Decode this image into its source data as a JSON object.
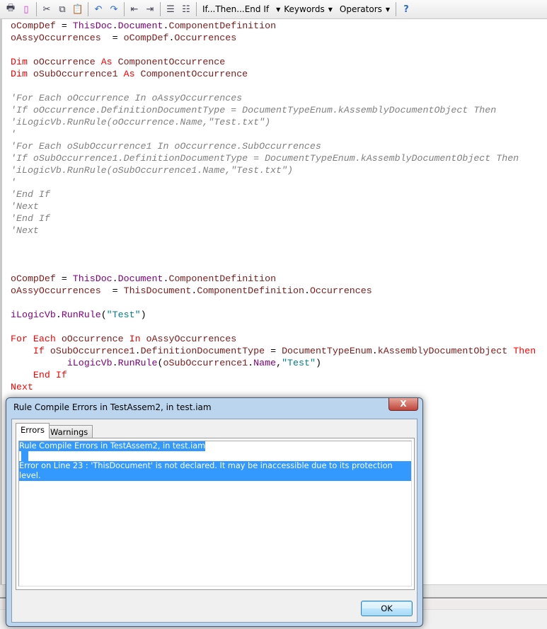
{
  "toolbar": {
    "icons": [
      "print-icon",
      "print-preview-icon",
      "cut-icon",
      "copy-icon",
      "paste-icon",
      "undo-icon",
      "redo-icon",
      "outdent-icon",
      "indent-icon",
      "comment-icon",
      "uncomment-icon"
    ],
    "if_then_label": "If...Then...End If",
    "keywords_label": "Keywords",
    "operators_label": "Operators",
    "help_icon": "help-icon"
  },
  "colors": {
    "variable": "#801818",
    "member": "#800080",
    "keyword": "#ff0000",
    "string": "#008080",
    "comment": "#808080",
    "selection": "#3399ff"
  },
  "code": {
    "lines": [
      {
        "tokens": [
          [
            "v",
            "oCompDef"
          ],
          [
            "o",
            " = "
          ],
          [
            "p",
            "ThisDoc"
          ],
          [
            "o",
            "."
          ],
          [
            "p",
            "Document"
          ],
          [
            "o",
            "."
          ],
          [
            "v",
            "ComponentDefinition"
          ]
        ]
      },
      {
        "tokens": [
          [
            "v",
            "oAssyOccurrences"
          ],
          [
            "o",
            "  = "
          ],
          [
            "v",
            "oCompDef"
          ],
          [
            "o",
            "."
          ],
          [
            "v",
            "Occurrences"
          ]
        ]
      },
      {
        "tokens": []
      },
      {
        "tokens": [
          [
            "k",
            "Dim "
          ],
          [
            "v",
            "oOccurrence "
          ],
          [
            "k",
            "As "
          ],
          [
            "v",
            "ComponentOccurrence"
          ]
        ]
      },
      {
        "tokens": [
          [
            "k",
            "Dim "
          ],
          [
            "v",
            "oSubOccurrence1 "
          ],
          [
            "k",
            "As "
          ],
          [
            "v",
            "ComponentOccurrence"
          ]
        ]
      },
      {
        "tokens": []
      },
      {
        "tokens": [
          [
            "c",
            "'For Each oOccurrence In oAssyOccurrences"
          ]
        ]
      },
      {
        "tokens": [
          [
            "c",
            "'If oOccurrence.DefinitionDocumentType = DocumentTypeEnum.kAssemblyDocumentObject Then"
          ]
        ]
      },
      {
        "tokens": [
          [
            "c",
            "'iLogicVb.RunRule(oOccurrence.Name,\"Test.txt\")"
          ]
        ]
      },
      {
        "tokens": [
          [
            "c",
            "'"
          ]
        ]
      },
      {
        "tokens": [
          [
            "c",
            "'For Each oSubOccurrence1 In oOccurrence.SubOccurrences"
          ]
        ]
      },
      {
        "tokens": [
          [
            "c",
            "'If oSubOccurrence1.DefinitionDocumentType = DocumentTypeEnum.kAssemblyDocumentObject Then"
          ]
        ]
      },
      {
        "tokens": [
          [
            "c",
            "'iLogicVb.RunRule(oSubOccurrence1.Name,\"Test.txt\")"
          ]
        ]
      },
      {
        "tokens": [
          [
            "c",
            "'"
          ]
        ]
      },
      {
        "tokens": [
          [
            "c",
            "'End If"
          ]
        ]
      },
      {
        "tokens": [
          [
            "c",
            "'Next"
          ]
        ]
      },
      {
        "tokens": [
          [
            "c",
            "'End If"
          ]
        ]
      },
      {
        "tokens": [
          [
            "c",
            "'Next"
          ]
        ]
      },
      {
        "tokens": []
      },
      {
        "tokens": []
      },
      {
        "tokens": []
      },
      {
        "tokens": [
          [
            "v",
            "oCompDef"
          ],
          [
            "o",
            " = "
          ],
          [
            "p",
            "ThisDoc"
          ],
          [
            "o",
            "."
          ],
          [
            "p",
            "Document"
          ],
          [
            "o",
            "."
          ],
          [
            "v",
            "ComponentDefinition"
          ]
        ]
      },
      {
        "tokens": [
          [
            "v",
            "oAssyOccurrences"
          ],
          [
            "o",
            "  = "
          ],
          [
            "v",
            "ThisDocument"
          ],
          [
            "o",
            "."
          ],
          [
            "v",
            "ComponentDefinition"
          ],
          [
            "o",
            "."
          ],
          [
            "v",
            "Occurrences"
          ]
        ]
      },
      {
        "tokens": []
      },
      {
        "tokens": [
          [
            "p",
            "iLogicVb"
          ],
          [
            "o",
            "."
          ],
          [
            "p",
            "RunRule"
          ],
          [
            "o",
            "("
          ],
          [
            "s",
            "\"Test\""
          ],
          [
            "o",
            ")"
          ]
        ]
      },
      {
        "tokens": []
      },
      {
        "tokens": [
          [
            "k",
            "For Each "
          ],
          [
            "v",
            "oOccurrence "
          ],
          [
            "k",
            "In "
          ],
          [
            "v",
            "oAssyOccurrences"
          ]
        ]
      },
      {
        "tokens": [
          [
            "o",
            "    "
          ],
          [
            "k",
            "If "
          ],
          [
            "v",
            "oSubOccurrence1"
          ],
          [
            "o",
            "."
          ],
          [
            "v",
            "DefinitionDocumentType"
          ],
          [
            "o",
            " = "
          ],
          [
            "v",
            "DocumentTypeEnum"
          ],
          [
            "o",
            "."
          ],
          [
            "v",
            "kAssemblyDocumentObject "
          ],
          [
            "k",
            "Then"
          ]
        ]
      },
      {
        "tokens": [
          [
            "o",
            "          "
          ],
          [
            "p",
            "iLogicVb"
          ],
          [
            "o",
            "."
          ],
          [
            "p",
            "RunRule"
          ],
          [
            "o",
            "("
          ],
          [
            "v",
            "oSubOccurrence1"
          ],
          [
            "o",
            "."
          ],
          [
            "p",
            "Name"
          ],
          [
            "o",
            ","
          ],
          [
            "s",
            "\"Test\""
          ],
          [
            "o",
            ")"
          ]
        ]
      },
      {
        "tokens": [
          [
            "o",
            "    "
          ],
          [
            "k",
            "End If"
          ]
        ]
      },
      {
        "tokens": [
          [
            "k",
            "Next"
          ]
        ]
      }
    ]
  },
  "dialog": {
    "title": "Rule Compile Errors in TestAssem2, in test.iam",
    "close_label": "X",
    "tabs": [
      {
        "label": "Errors",
        "active": true
      },
      {
        "label": "Warnings",
        "active": false
      }
    ],
    "messages": [
      "Rule Compile Errors in TestAssem2, in test.iam",
      "",
      "Error on Line 23 : 'ThisDocument' is not declared. It may be inaccessible due to its protection level."
    ],
    "ok_label": "OK"
  }
}
